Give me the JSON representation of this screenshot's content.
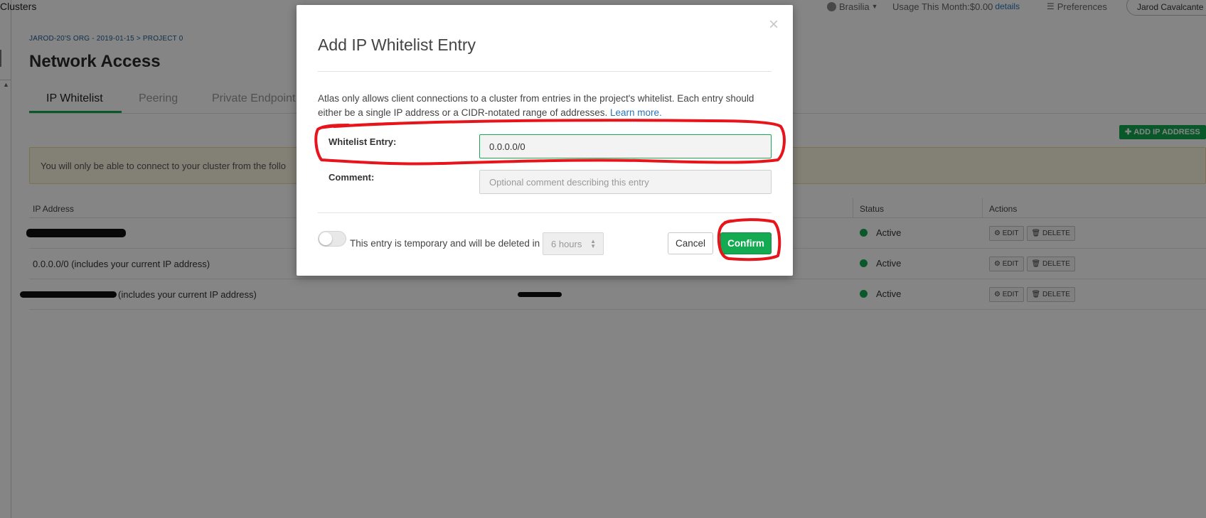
{
  "app": {
    "title": "Clusters"
  },
  "topbar": {
    "region": "Brasilia",
    "usage_label": "Usage This Month:$0.00",
    "usage_link": "details",
    "preferences": "Preferences",
    "user_name": "Jarod Cavalcante"
  },
  "page": {
    "breadcrumb": "JAROD-20'S ORG - 2019-01-15 > PROJECT 0",
    "title": "Network Access",
    "tabs": [
      {
        "label": "IP Whitelist",
        "active": true
      },
      {
        "label": "Peering",
        "active": false
      },
      {
        "label": "Private Endpoint",
        "active": false
      }
    ],
    "add_button": "ADD IP ADDRESS",
    "banner": "You will only be able to connect to your cluster from the follo"
  },
  "table": {
    "headers": {
      "ip": "IP Address",
      "status": "Status",
      "actions": "Actions"
    },
    "rows": [
      {
        "ip": "",
        "status": "Active",
        "edit": "EDIT",
        "delete": "DELETE"
      },
      {
        "ip": "0.0.0.0/0  (includes your current IP address)",
        "status": "Active",
        "edit": "EDIT",
        "delete": "DELETE"
      },
      {
        "ip": "(includes your current IP address)",
        "status": "Active",
        "edit": "EDIT",
        "delete": "DELETE"
      }
    ]
  },
  "modal": {
    "title": "Add IP Whitelist Entry",
    "description": "Atlas only allows client connections to a cluster from entries in the project's whitelist. Each entry should either be a single IP address or a CIDR-notated range of addresses.",
    "learn_more": "Learn more.",
    "whitelist_label": "Whitelist Entry:",
    "whitelist_value": "0.0.0.0/0",
    "comment_label": "Comment:",
    "comment_placeholder": "Optional comment describing this entry",
    "temporary_label": "This entry is temporary and will be deleted in",
    "temporary_enabled": false,
    "hours_value": "6 hours",
    "cancel": "Cancel",
    "confirm": "Confirm"
  },
  "colors": {
    "primary_green": "#13aa52",
    "link_blue": "#2a74b8",
    "annotation_red": "#e8141c",
    "banner_bg": "#fcf8e3"
  },
  "icons": {
    "close": "close-icon",
    "globe": "globe-icon",
    "preferences": "sliders-icon",
    "edit": "gear-icon",
    "delete": "trash-icon",
    "add": "plus-icon",
    "status": "status-dot-icon",
    "hours_spinner": "spinner-arrows-icon"
  }
}
